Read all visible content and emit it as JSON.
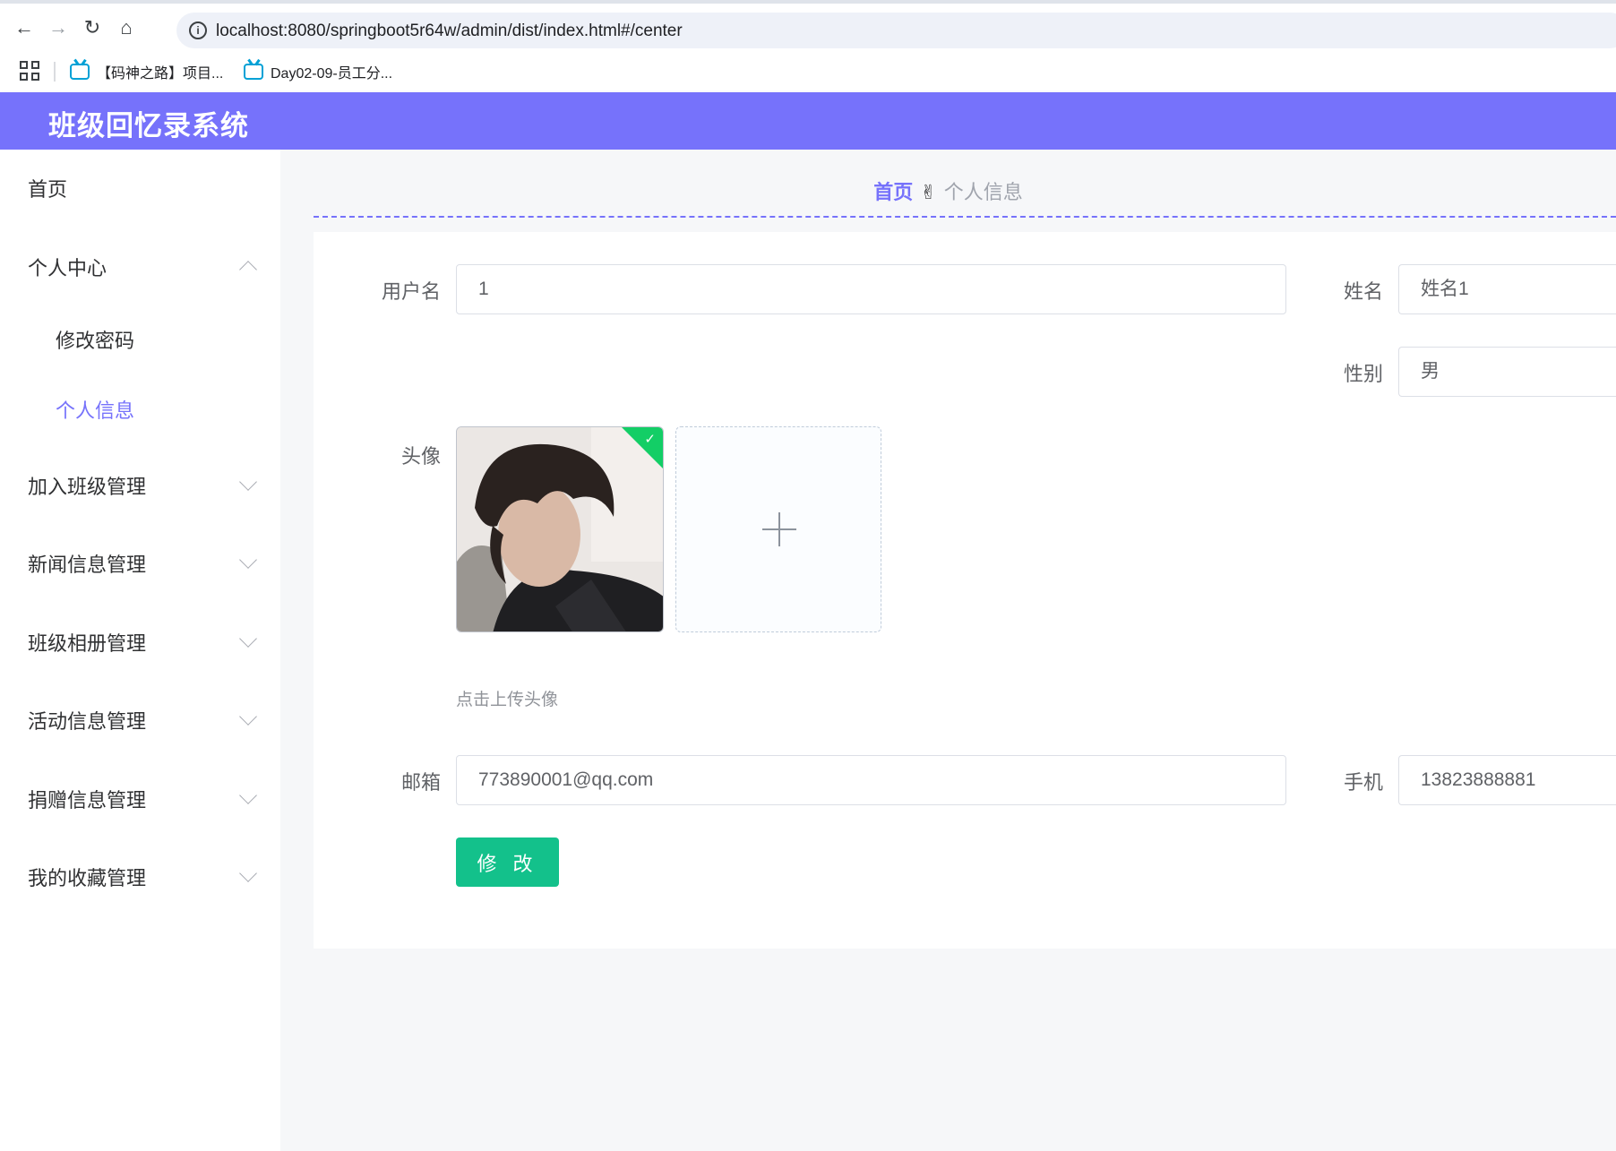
{
  "browser": {
    "url": "localhost:8080/springboot5r64w/admin/dist/index.html#/center",
    "bookmarks": [
      "【码神之路】项目...",
      "Day02-09-员工分..."
    ]
  },
  "app": {
    "title": "班级回忆录系统"
  },
  "sidebar": {
    "items": [
      {
        "label": "首页"
      },
      {
        "label": "个人中心",
        "expanded": true
      },
      {
        "label": "修改密码"
      },
      {
        "label": "个人信息",
        "active": true
      },
      {
        "label": "加入班级管理"
      },
      {
        "label": "新闻信息管理"
      },
      {
        "label": "班级相册管理"
      },
      {
        "label": "活动信息管理"
      },
      {
        "label": "捐赠信息管理"
      },
      {
        "label": "我的收藏管理"
      }
    ]
  },
  "breadcrumb": {
    "home": "首页",
    "separator_icon": "hand-icon",
    "current": "个人信息"
  },
  "form": {
    "username": {
      "label": "用户名",
      "value": "1"
    },
    "name": {
      "label": "姓名",
      "value": "姓名1"
    },
    "gender": {
      "label": "性别",
      "value": "男"
    },
    "avatar": {
      "label": "头像",
      "tip": "点击上传头像"
    },
    "email": {
      "label": "邮箱",
      "value": "773890001@qq.com"
    },
    "phone": {
      "label": "手机",
      "value": "13823888881"
    },
    "submit_label": "修 改"
  },
  "colors": {
    "accent": "#7672fb",
    "success": "#13c18b"
  }
}
